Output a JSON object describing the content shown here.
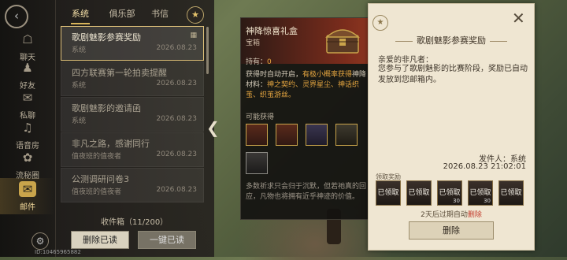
{
  "sidebar": {
    "back_icon": "back-arrow-icon",
    "items": [
      {
        "label": "聊天",
        "icon": "chat-bubble-icon",
        "glyph": "☖"
      },
      {
        "label": "好友",
        "icon": "friends-icon",
        "glyph": "♟"
      },
      {
        "label": "私聊",
        "icon": "private-chat-icon",
        "glyph": "✉"
      },
      {
        "label": "语音房",
        "icon": "voice-room-icon",
        "glyph": "♫"
      },
      {
        "label": "流秘圈",
        "icon": "circle-icon",
        "glyph": "✿"
      },
      {
        "label": "邮件",
        "icon": "mail-icon",
        "glyph": "✉"
      }
    ],
    "user_id": "ID:10465965882"
  },
  "tabs": [
    "系统",
    "俱乐部",
    "书信"
  ],
  "mail_list": [
    {
      "title": "歌剧魅影参赛奖励",
      "sub": "系统",
      "date": "2026.08.23",
      "has_gift": true
    },
    {
      "title": "四方联赛第一轮拍卖提醒",
      "sub": "系统",
      "date": "2026.08.23",
      "has_gift": false
    },
    {
      "title": "歌剧魅影的邀请函",
      "sub": "系统",
      "date": "2026.08.23",
      "has_gift": false
    },
    {
      "title": "非凡之路，感谢同行",
      "sub": "值夜班的值夜者",
      "date": "2026.08.23",
      "has_gift": false
    },
    {
      "title": "公测调研问卷3",
      "sub": "值夜班的值夜者",
      "date": "2026.08.23",
      "has_gift": false
    }
  ],
  "inbox_count": "收件箱（11/200）",
  "buttons": {
    "delete_read": "删除已读",
    "collect_all": "一键已读"
  },
  "tooltip": {
    "name": "神降惊喜礼盒",
    "type": "宝箱",
    "owned_label": "持有：",
    "owned_value": "0",
    "desc_prefix": "获得时自动开启，",
    "desc_highlight": "有极小概率获得",
    "desc_mid": "神降材料：",
    "desc_items": "神之契约、灵界星尘、神话织茧、织茧游丝。",
    "possible_label": "可能获得",
    "lore": "多数祈求只会归于沉默，但若祂真的回应，凡物也将拥有近乎神迹的价值。"
  },
  "detail": {
    "title": "歌剧魅影参赛奖励",
    "greeting": "亲爱的非凡者：",
    "body": "您参与了歌剧魅影的比赛阶段，奖励已自动发放到您邮箱内。",
    "sender": "发件人：系统",
    "date": "2026.08.23 21:02:01",
    "reward_label": "领取奖励",
    "rewards": [
      {
        "label": "已领取",
        "count": ""
      },
      {
        "label": "已领取",
        "count": ""
      },
      {
        "label": "已领取",
        "count": "30"
      },
      {
        "label": "已领取",
        "count": "30"
      },
      {
        "label": "已领取",
        "count": ""
      }
    ],
    "expire_prefix": "2天后过期自动",
    "expire_action": "删除",
    "delete_button": "删除"
  },
  "colors": {
    "accent_gold": "#d8b45a",
    "highlight_orange": "#e6a640",
    "expire_red": "#c23b2b"
  }
}
